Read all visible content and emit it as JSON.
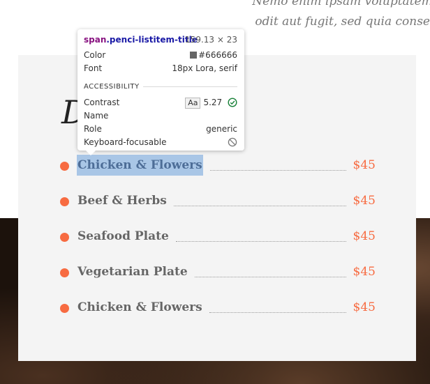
{
  "top_quote": {
    "line1": "Nemo enim ipsam voluptatem q",
    "line2": "odit aut fugit, sed quia conse"
  },
  "heading_partial": "D",
  "menu": {
    "items": [
      {
        "title": "Chicken & Flowers",
        "price": "$45"
      },
      {
        "title": "Beef & Herbs",
        "price": "$45"
      },
      {
        "title": "Seafood Plate",
        "price": "$45"
      },
      {
        "title": "Vegetarian Plate",
        "price": "$45"
      },
      {
        "title": "Chicken & Flowers",
        "price": "$45"
      }
    ],
    "accent_color": "#f76b41",
    "title_color": "#666666"
  },
  "inspector": {
    "tag": "span",
    "class_name": ".penci-listitem-title",
    "dimensions": "159.13 × 23",
    "color_label": "Color",
    "color_value": "#666666",
    "font_label": "Font",
    "font_value": "18px Lora, serif",
    "section_title": "ACCESSIBILITY",
    "contrast_label": "Contrast",
    "contrast_badge": "Aa",
    "contrast_value": "5.27",
    "name_label": "Name",
    "role_label": "Role",
    "role_value": "generic",
    "keyboard_label": "Keyboard-focusable",
    "icons": {
      "contrast_ok": "check-circle-icon",
      "not_focusable": "no-entry-icon"
    }
  }
}
